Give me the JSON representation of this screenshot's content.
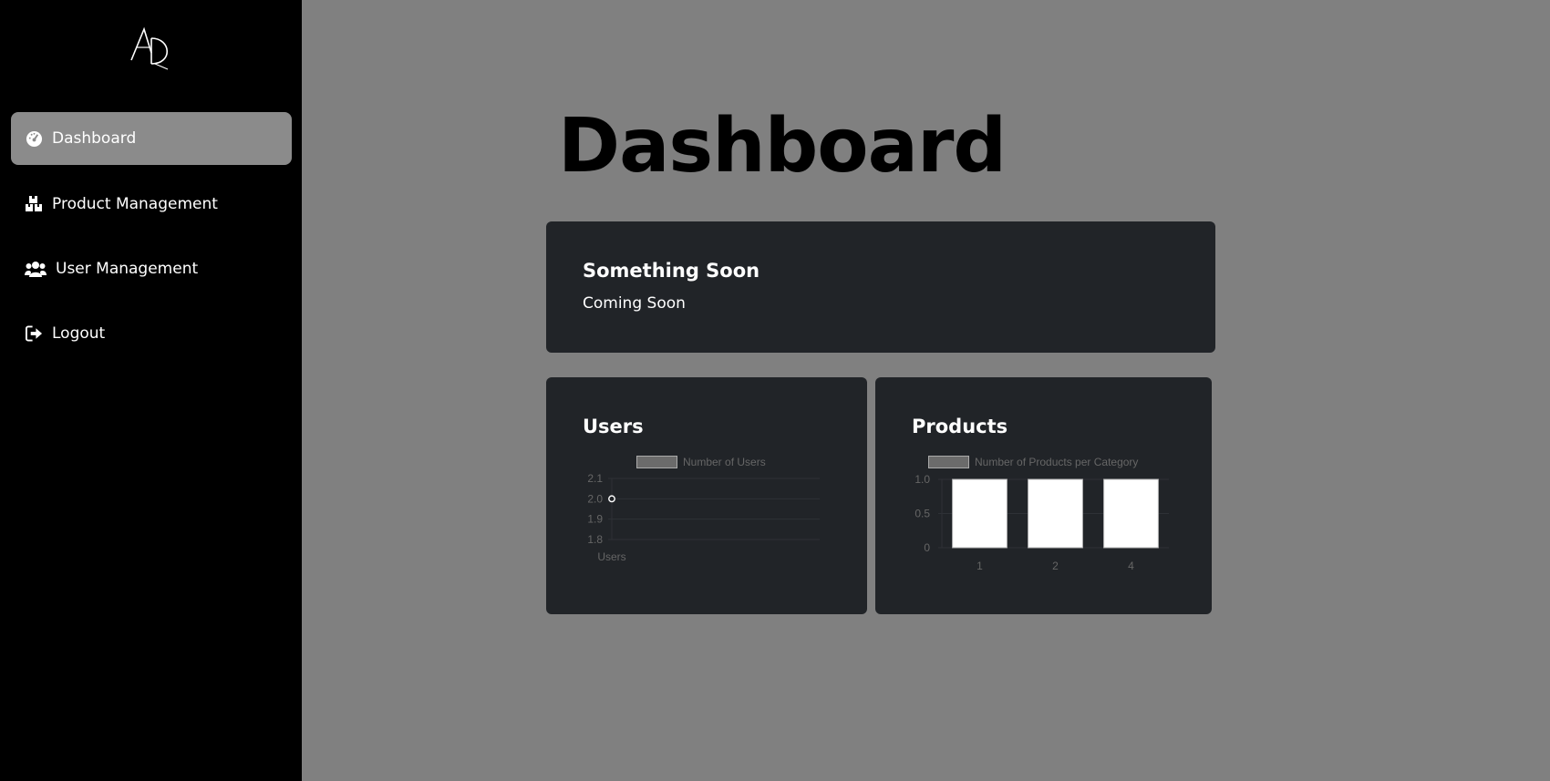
{
  "sidebar": {
    "logo_icon": "ad-monogram-logo",
    "items": [
      {
        "label": "Dashboard",
        "icon": "dashboard-gauge-icon",
        "active": true
      },
      {
        "label": "Product Management",
        "icon": "boxes-icon",
        "active": false
      },
      {
        "label": "User Management",
        "icon": "users-icon",
        "active": false
      },
      {
        "label": "Logout",
        "icon": "logout-icon",
        "active": false
      }
    ]
  },
  "main": {
    "title": "Dashboard"
  },
  "cards": {
    "soon": {
      "title": "Something Soon",
      "text": "Coming Soon"
    },
    "users": {
      "title": "Users"
    },
    "products": {
      "title": "Products"
    }
  },
  "colors": {
    "page_bg": "#808080",
    "sidebar_bg": "#000000",
    "active_item_bg": "#8b8b8b",
    "card_bg": "#212428",
    "chart_text": "#666666"
  },
  "chart_data": [
    {
      "type": "line",
      "legend": [
        "Number of Users"
      ],
      "x": [
        "Users"
      ],
      "series": [
        {
          "name": "Number of Users",
          "values": [
            2.0
          ]
        }
      ],
      "ylim": [
        1.8,
        2.1
      ],
      "yticks": [
        "2.1",
        "2.0",
        "1.9",
        "1.8"
      ],
      "grid": true,
      "legend_position": "top"
    },
    {
      "type": "bar",
      "legend": [
        "Number of Products per Category"
      ],
      "categories": [
        "1",
        "2",
        "4"
      ],
      "series": [
        {
          "name": "Number of Products per Category",
          "values": [
            1,
            1,
            1
          ]
        }
      ],
      "ylim": [
        0,
        1
      ],
      "yticks": [
        "1.0",
        "0.5",
        "0"
      ],
      "grid": true,
      "legend_position": "top"
    }
  ]
}
